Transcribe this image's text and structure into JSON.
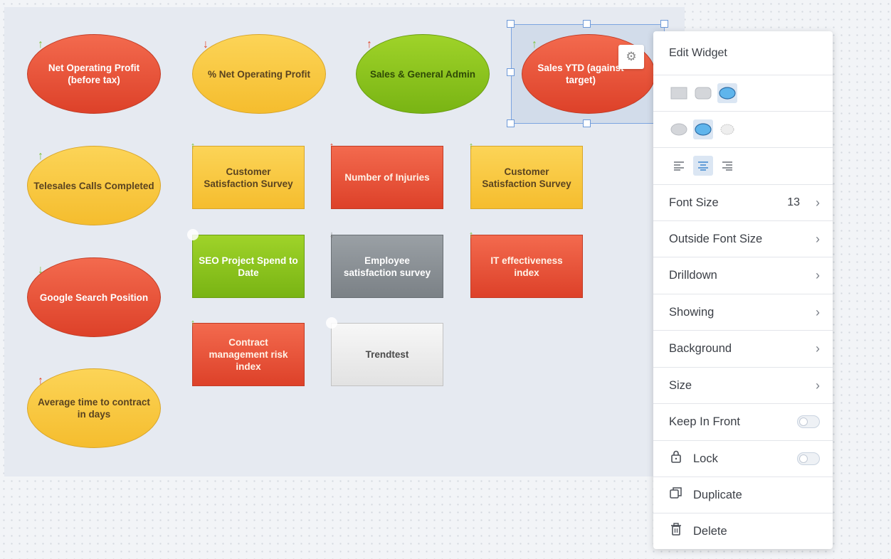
{
  "widgets": {
    "net_operating_profit": "Net Operating Profit (before tax)",
    "pct_net_operating_profit": "% Net Operating Profit",
    "sales_general_admin": "Sales & General Admin",
    "sales_ytd": "Sales YTD (against target)",
    "telesales_calls": "Telesales Calls Completed",
    "customer_satisfaction_1": "Customer Satisfaction Survey",
    "number_of_injuries": "Number of Injuries",
    "customer_satisfaction_2": "Customer Satisfaction Survey",
    "google_search_position": "Google Search Position",
    "seo_project_spend": "SEO Project Spend to Date",
    "employee_satisfaction": "Employee satisfaction survey",
    "it_effectiveness": "IT effectiveness index",
    "contract_risk": "Contract management risk index",
    "trendtest": "Trendtest",
    "avg_time_contract": "Average time to contract in days"
  },
  "panel": {
    "title": "Edit Widget",
    "font_size_label": "Font Size",
    "font_size_value": "13",
    "outside_font_size_label": "Outside Font Size",
    "drilldown_label": "Drilldown",
    "showing_label": "Showing",
    "background_label": "Background",
    "size_label": "Size",
    "keep_in_front_label": "Keep In Front",
    "lock_label": "Lock",
    "duplicate_label": "Duplicate",
    "delete_label": "Delete"
  },
  "colors": {
    "red": "#e34a30",
    "yellow": "#f8c53a",
    "green": "#8cc51f",
    "gray": "#888e93",
    "accent": "#5b9bd5"
  }
}
